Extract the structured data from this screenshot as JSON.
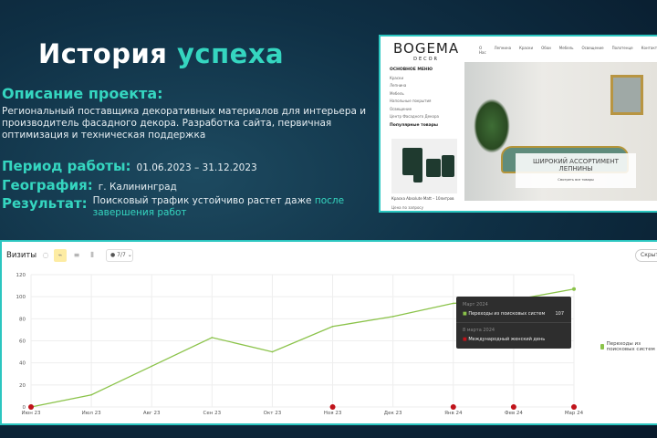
{
  "title": {
    "part1": "История",
    "part2": "успеха"
  },
  "description": {
    "heading": "Описание проекта:",
    "text": "Региональный поставщика декоративных материалов для интерьера и производитель фасадного декора. Разработка сайта, первичная оптимизация и техническая поддержка"
  },
  "period": {
    "label": "Период работы:",
    "value": "01.06.2023 – 31.12.2023"
  },
  "geo": {
    "label": "География:",
    "value": "г. Калининград"
  },
  "result": {
    "label": "Результат:",
    "value": "Поисковый трафик устойчиво растет даже ",
    "highlight": "после завершения работ"
  },
  "site": {
    "logo": "BOGEMA",
    "logo_sub": "DECOR",
    "nav": [
      "О Нас",
      "Лепнина",
      "Краски",
      "Обои",
      "Мебель",
      "Освещение",
      "Полотенце",
      "Контакты"
    ],
    "menu_title": "ОСНОВНОЕ МЕНЮ",
    "menu": [
      "Краски",
      "Лепнина",
      "Мебель",
      "Напольные покрытия",
      "Освещение",
      "Центр Фасадного Декора"
    ],
    "popular": "Популярные товары",
    "product": "Краска Absolute Matt – 10литров",
    "price": "Цена по запросу",
    "banner_title": "ШИРОКИЙ АССОРТИМЕНТ ЛЕПНИНЫ",
    "banner_link": "Смотреть все товары"
  },
  "panel": {
    "title": "Визиты",
    "segments": "7/7",
    "hide": "Скрыть",
    "legend": "Переходы из поисковых систем"
  },
  "tooltip": {
    "date": "Март 2024",
    "series": "Переходы из поисковых систем",
    "value": "107",
    "event_date": "8 марта 2024",
    "event": "Международный женский день"
  },
  "chart_data": {
    "type": "line",
    "categories": [
      "Июн 23",
      "Июл 23",
      "Авг 23",
      "Сен 23",
      "Окт 23",
      "Ноя 23",
      "Дек 23",
      "Янв 24",
      "Фев 24",
      "Мар 24"
    ],
    "series": [
      {
        "name": "Переходы из поисковых систем",
        "values": [
          0,
          11,
          37,
          63,
          50,
          73,
          82,
          94,
          97,
          107
        ],
        "color": "#8bc34a"
      }
    ],
    "ylim": [
      0,
      120
    ],
    "yticks": [
      0,
      20,
      40,
      60,
      80,
      100,
      120
    ],
    "grid": true,
    "event_markers": [
      "Июн 23",
      "Ноя 23",
      "Янв 24",
      "Фев 24",
      "Мар 24"
    ]
  }
}
